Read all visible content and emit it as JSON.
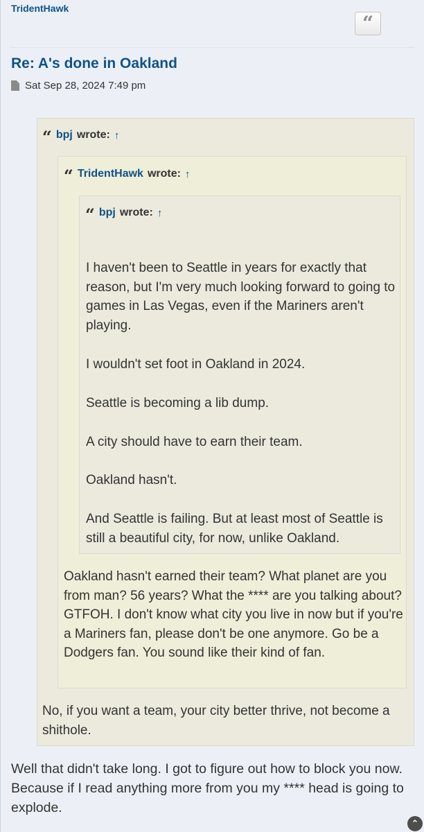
{
  "post": {
    "author": "TridentHawk",
    "title": "Re: A's done in Oakland",
    "date": "Sat Sep 28, 2024 7:49 pm",
    "quote_button_glyph": "“",
    "quote_icon_glyph": "“"
  },
  "quotes": {
    "level1": {
      "author": "bpj",
      "wrote": "wrote:",
      "arrow": "↑"
    },
    "level2": {
      "author": "TridentHawk",
      "wrote": "wrote:",
      "arrow": "↑"
    },
    "level3": {
      "author": "bpj",
      "wrote": "wrote:",
      "arrow": "↑"
    }
  },
  "level3_paragraphs": [
    "I haven't been to Seattle in years for exactly that reason, but I'm very much looking forward to going to games in Las Vegas, even if the Mariners aren't playing.",
    "I wouldn't set foot in Oakland in 2024.",
    "Seattle is becoming a lib dump.",
    "A city should have to earn their team.",
    "Oakland hasn't.",
    "And Seattle is failing. But at least most of Seattle is still a beautiful city, for now, unlike Oakland."
  ],
  "level2_text": "Oakland hasn't earned their team? What planet are you from man? 56 years? What the **** are you talking about? GTFOH. I don't know what city you live in now but if you're a Mariners fan, please don't be one anymore. Go be a Dodgers fan. You sound like their kind of fan.",
  "level1_text": "No, if you want a team, your city better thrive, not become a shithole.",
  "reply_text": "Well that didn't take long. I got to figure out how to block you now. Because if I read anything more from you my **** head is going to explode.",
  "scroll_top_glyph": "⌃",
  "colors": {
    "page_background": "#ecf0f6",
    "link": "#105289",
    "quote_background": "#ebeadd",
    "text": "#333333"
  }
}
